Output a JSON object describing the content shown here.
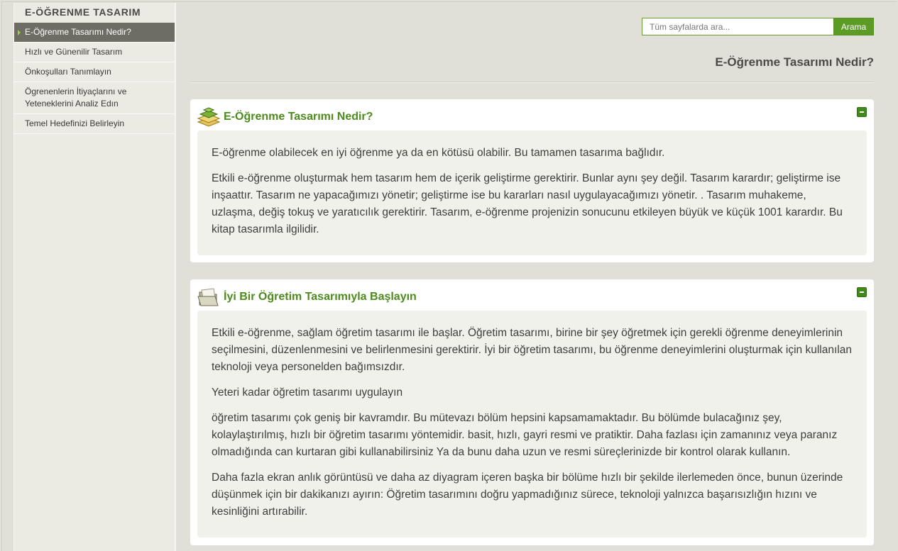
{
  "sidebar": {
    "title": "E-ÖĞRENME TASARIM",
    "items": [
      {
        "label": "E-Öğrenme Tasarımı Nedir?",
        "active": true
      },
      {
        "label": "Hızlı ve Günenilir Tasarım",
        "active": false
      },
      {
        "label": "Önkoşulları Tanımlayın",
        "active": false
      },
      {
        "label": "Ögrenenlerin İtiyaçlarını ve Yeteneklerini Analiz Edın",
        "active": false
      },
      {
        "label": "Temel Hedefinizi Belirleyin",
        "active": false
      }
    ]
  },
  "search": {
    "placeholder": "Tüm sayfalarda ara...",
    "button_label": "Arama"
  },
  "page": {
    "title": "E-Öğrenme Tasarımı Nedir?"
  },
  "panels": [
    {
      "title": "E-Öğrenme Tasarımı Nedir?",
      "icon": "layers-icon",
      "paragraphs": [
        "E-öğrenme olabilecek en iyi öğrenme ya da en kötüsü olabilir. Bu tamamen tasarıma bağlıdır.",
        "Etkili e-öğrenme oluşturmak hem tasarım hem de içerik geliştirme gerektirir.  Bunlar aynı şey değil. Tasarım karardır; geliştirme ise inşaattır. Tasarım ne yapacağımızı yönetir; geliştirme ise bu kararları nasıl uygulayacağımızı yönetir. . Tasarım muhakeme, uzlaşma, değiş tokuş ve yaratıcılık gerektirir.  Tasarım, e-öğrenme projenizin sonucunu etkileyen büyük ve küçük 1001 karardır. Bu kitap tasarımla ilgilidir."
      ]
    },
    {
      "title": "İyi Bir Öğretim Tasarımıyla Başlayın",
      "icon": "folder-icon",
      "paragraphs": [
        "Etkili e-öğrenme, sağlam öğretim tasarımı ile başlar. Öğretim tasarımı, birine bir şey öğretmek için gerekli öğrenme deneyimlerinin seçilmesini, düzenlenmesini ve belirlenmesini gerektirir. İyi bir öğretim tasarımı, bu öğrenme deneyimlerini oluşturmak için kullanılan teknoloji veya personelden bağımsızdır.",
        "Yeteri kadar öğretim tasarımı uygulayın",
        "öğretim tasarımı çok geniş bir kavramdır. Bu mütevazı bölüm hepsini kapsamamaktadır. Bu bölümde bulacağınız şey, kolaylaştırılmış, hızlı bir öğretim tasarımı yöntemidir. basit, hızlı, gayri resmi ve pratiktir. Daha fazlası için zamanınız veya paranız olmadığında can kurtaran gibi kullanabilirsiniz Ya da bunu daha uzun ve resmi süreçlerinizde bir kontrol olarak kullanın.",
        "Daha fazla ekran anlık görüntüsü ve daha az diyagram içeren başka bir bölüme hızlı bir şekilde ilerlemeden önce, bunun üzerinde düşünmek için bir dakikanızı ayırın: Öğretim tasarımını doğru yapmadığınız sürece, teknoloji yalnızca başarısızlığın hızını ve kesinliğini artırabilir."
      ]
    }
  ],
  "colors": {
    "accent": "#5c9b24",
    "title_green": "#4c8b1c",
    "sidebar_active": "#6e6d63",
    "background": "#e0dfd8"
  }
}
